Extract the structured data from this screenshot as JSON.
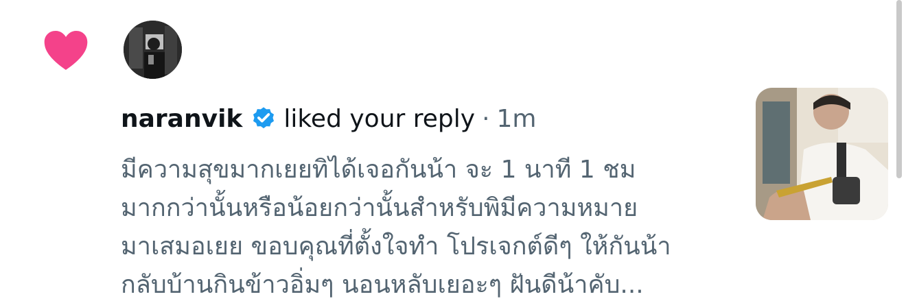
{
  "notification": {
    "type": "like",
    "username": "naranvik",
    "verified": true,
    "action": "liked your reply",
    "separator": "·",
    "timestamp": "1m",
    "reply_lines": [
      "มีความสุขมากเยยทิได้เจอกันน้า จะ 1 นาที 1 ชม",
      "มากกว่านั้นหรือน้อยกว่านั้นสำหรับพิมีความหมาย",
      "มาเสมอเยย ขอบคุณที่ตั้งใจทำ โปรเจกต์ดีๆ ให้กันน้า",
      "กลับบ้านกินข้าวอิ่มๆ นอนหลับเยอะๆ ฝันดีน้าคับ..."
    ]
  },
  "icons": {
    "like": "heart-icon",
    "verified": "verified-badge-icon"
  },
  "colors": {
    "heart": "#f4428a",
    "verified": "#1d9bf0",
    "primary_text": "#0f1419",
    "secondary_text": "#536471"
  }
}
